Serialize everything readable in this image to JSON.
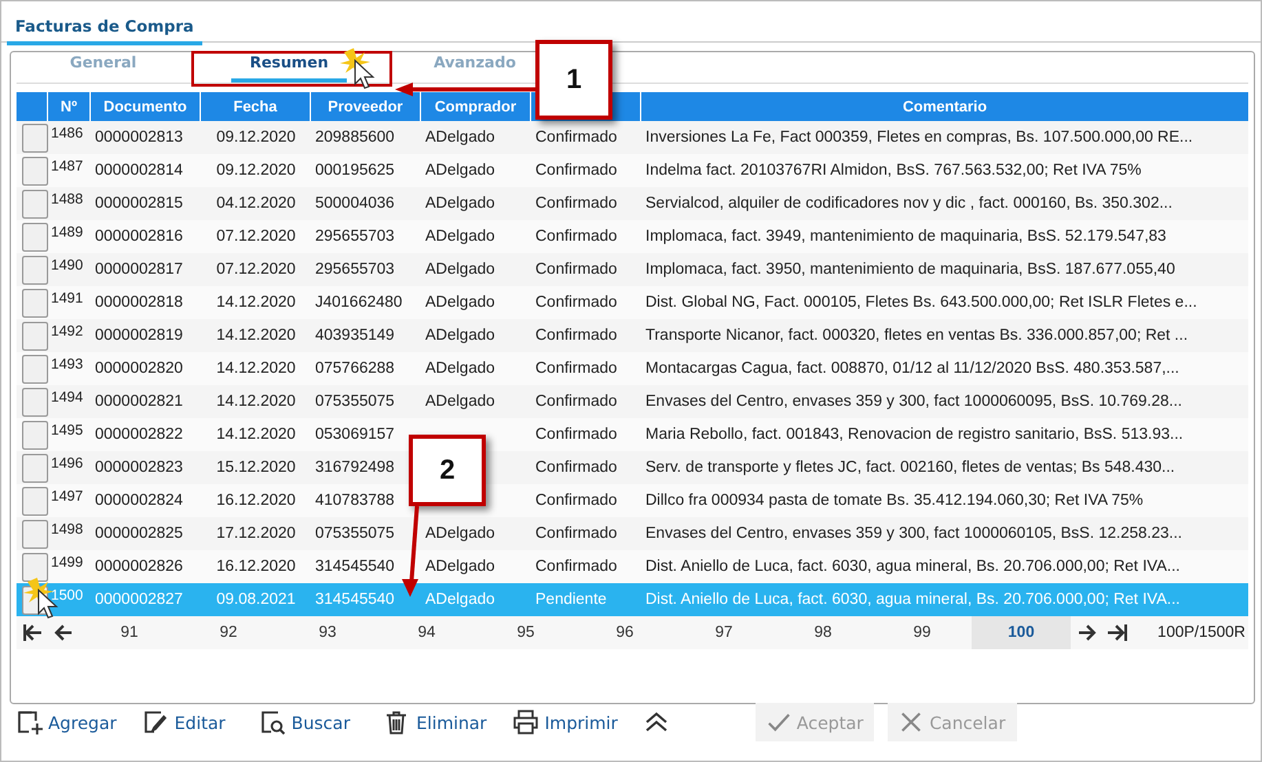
{
  "title_tab": {
    "label": "Facturas de Compra",
    "selected": true
  },
  "tabs": [
    {
      "label": "General",
      "selected": false
    },
    {
      "label": "Resumen",
      "selected": true
    },
    {
      "label": "Avanzado",
      "selected": false
    }
  ],
  "table": {
    "columns": [
      null,
      "Nº",
      "Documento",
      "Fecha",
      "Proveedor",
      "Comprador",
      null,
      "Comentario"
    ],
    "rows": [
      {
        "no": "1486",
        "documento": "0000002813",
        "fecha": "09.12.2020",
        "proveedor": "209885600",
        "comprador": "ADelgado",
        "estado": "Confirmado",
        "comentario": "Inversiones La Fe, Fact 000359, Fletes en compras, Bs. 107.500.000,00 RE...",
        "selected": false
      },
      {
        "no": "1487",
        "documento": "0000002814",
        "fecha": "09.12.2020",
        "proveedor": "000195625",
        "comprador": "ADelgado",
        "estado": "Confirmado",
        "comentario": "Indelma fact. 20103767RI Almidon, BsS. 767.563.532,00; Ret IVA 75%",
        "selected": false
      },
      {
        "no": "1488",
        "documento": "0000002815",
        "fecha": "04.12.2020",
        "proveedor": "500004036",
        "comprador": "ADelgado",
        "estado": "Confirmado",
        "comentario": "Servialcod, alquiler de codificadores nov y dic , fact. 000160, Bs. 350.302...",
        "selected": false
      },
      {
        "no": "1489",
        "documento": "0000002816",
        "fecha": "07.12.2020",
        "proveedor": "295655703",
        "comprador": "ADelgado",
        "estado": "Confirmado",
        "comentario": "Implomaca, fact. 3949, mantenimiento de maquinaria, BsS. 52.179.547,83",
        "selected": false
      },
      {
        "no": "1490",
        "documento": "0000002817",
        "fecha": "07.12.2020",
        "proveedor": "295655703",
        "comprador": "ADelgado",
        "estado": "Confirmado",
        "comentario": "Implomaca, fact. 3950, mantenimiento de maquinaria, BsS. 187.677.055,40",
        "selected": false
      },
      {
        "no": "1491",
        "documento": "0000002818",
        "fecha": "14.12.2020",
        "proveedor": "J401662480",
        "comprador": "ADelgado",
        "estado": "Confirmado",
        "comentario": "Dist. Global NG, Fact. 000105, Fletes Bs. 643.500.000,00; Ret ISLR Fletes e...",
        "selected": false
      },
      {
        "no": "1492",
        "documento": "0000002819",
        "fecha": "14.12.2020",
        "proveedor": "403935149",
        "comprador": "ADelgado",
        "estado": "Confirmado",
        "comentario": "Transporte Nicanor, fact. 000320, fletes en ventas Bs. 336.000.857,00; Ret ...",
        "selected": false
      },
      {
        "no": "1493",
        "documento": "0000002820",
        "fecha": "14.12.2020",
        "proveedor": "075766288",
        "comprador": "ADelgado",
        "estado": "Confirmado",
        "comentario": "Montacargas Cagua, fact. 008870, 01/12 al 11/12/2020 BsS. 480.353.587,...",
        "selected": false
      },
      {
        "no": "1494",
        "documento": "0000002821",
        "fecha": "14.12.2020",
        "proveedor": "075355075",
        "comprador": "ADelgado",
        "estado": "Confirmado",
        "comentario": "Envases del Centro, envases 359 y 300, fact 1000060095, BsS. 10.769.28...",
        "selected": false
      },
      {
        "no": "1495",
        "documento": "0000002822",
        "fecha": "14.12.2020",
        "proveedor": "053069157",
        "estado": "Confirmado",
        "comentario": "Maria Rebollo, fact. 001843, Renovacion de registro sanitario, BsS. 513.93...",
        "selected": false
      },
      {
        "no": "1496",
        "documento": "0000002823",
        "fecha": "15.12.2020",
        "proveedor": "316792498",
        "estado": "Confirmado",
        "comentario": "Serv. de transporte y fletes JC, fact. 002160, fletes de ventas; Bs 548.430...",
        "selected": false
      },
      {
        "no": "1497",
        "documento": "0000002824",
        "fecha": "16.12.2020",
        "proveedor": "410783788",
        "estado": "Confirmado",
        "comentario": "Dillco fra 000934 pasta de tomate Bs. 35.412.194.060,30; Ret IVA 75%",
        "selected": false
      },
      {
        "no": "1498",
        "documento": "0000002825",
        "fecha": "17.12.2020",
        "proveedor": "075355075",
        "comprador": "ADelgado",
        "estado": "Confirmado",
        "comentario": "Envases del Centro, envases 359 y 300, fact 1000060105, BsS. 12.258.23...",
        "selected": false
      },
      {
        "no": "1499",
        "documento": "0000002826",
        "fecha": "16.12.2020",
        "proveedor": "314545540",
        "comprador": "ADelgado",
        "estado": "Confirmado",
        "comentario": "Dist. Aniello de Luca, fact. 6030, agua mineral, Bs. 20.706.000,00; Ret IVA...",
        "selected": false
      },
      {
        "no": "1500",
        "documento": "0000002827",
        "fecha": "09.08.2021",
        "proveedor": "314545540",
        "comprador": "ADelgado",
        "estado": "Pendiente",
        "comentario": "Dist. Aniello de Luca, fact. 6030, agua mineral, Bs. 20.706.000,00; Ret IVA...",
        "selected": true
      }
    ]
  },
  "pager": {
    "pages": [
      {
        "label": "91",
        "selected": false
      },
      {
        "label": "92",
        "selected": false
      },
      {
        "label": "93",
        "selected": false
      },
      {
        "label": "94",
        "selected": false
      },
      {
        "label": "95",
        "selected": false
      },
      {
        "label": "96",
        "selected": false
      },
      {
        "label": "97",
        "selected": false
      },
      {
        "label": "98",
        "selected": false
      },
      {
        "label": "99",
        "selected": false
      },
      {
        "label": "100",
        "selected": true
      }
    ],
    "summary": "100P/1500R"
  },
  "toolbar": [
    {
      "kind": "add",
      "label": "Agregar",
      "disabled": false
    },
    {
      "kind": "edit",
      "label": "Editar",
      "disabled": false
    },
    {
      "kind": "search",
      "label": "Buscar",
      "disabled": false
    },
    {
      "kind": "delete",
      "label": "Eliminar",
      "disabled": false
    },
    {
      "kind": "print",
      "label": "Imprimir",
      "disabled": false
    },
    {
      "kind": "collapse",
      "disabled": false
    },
    {
      "kind": "accept",
      "label": "Aceptar",
      "disabled": true
    },
    {
      "kind": "cancel",
      "label": "Cancelar",
      "disabled": true
    }
  ],
  "callouts": [
    {
      "label": "1"
    },
    {
      "label": "2"
    }
  ]
}
